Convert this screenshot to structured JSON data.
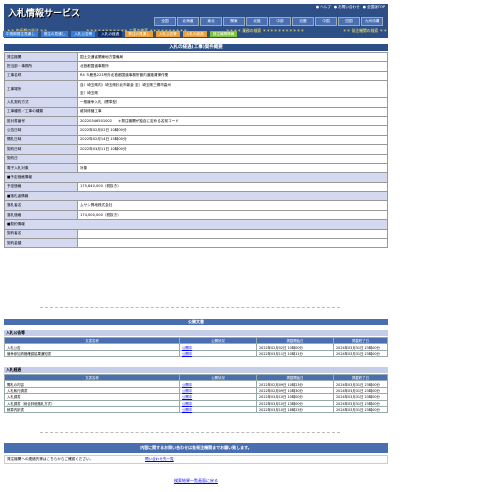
{
  "header": {
    "title": "入札情報サービス",
    "top_links": [
      "● ヘルプ",
      "● お問い合わせ",
      "● 全国版TOP"
    ],
    "regions": [
      "全国",
      "北海道",
      "東北",
      "関東",
      "北陸",
      "中部",
      "近畿",
      "中国",
      "四国",
      "九州沖縄"
    ],
    "search_links": [
      "＊＊ 中長期の発注 ＊＊",
      "＊＊＊＊＊＊＊＊＊＊＊ 工事の検索 ＊＊＊＊＊＊＊＊＊＊",
      "＊＊＊＊ 業務の検索 ＊＊＊＊＊＊＊＊＊＊＊",
      "＊＊ 発注機関の検索 ＊＊"
    ],
    "tabs": [
      "中長期発注見通し",
      "発注の見通し",
      "入札公告等",
      "入札の経過",
      "発注の見通し",
      "入札公告等",
      "入札の経過",
      "発注機関情報"
    ]
  },
  "section_title": "入札の経過(工事)案件概要",
  "info": [
    {
      "label": "発注機関",
      "value": "国土交通省関東地方整備局"
    },
    {
      "label": "担当部・事務所",
      "value": "北首都国道事務所"
    },
    {
      "label": "工事名称",
      "value": "R4 Ｓ鹿島223号外北首都国道事務所管内道路清掃作業"
    },
    {
      "label": "工事場所",
      "value": "自）埼玉県内）埼玉県杉北市新倉 至）埼玉県三郷市高州",
      "value2": "至）埼玉県"
    },
    {
      "label": "入札契約方式",
      "value": "一般競争入札（標準型）"
    },
    {
      "label": "工事種別／工事の種類",
      "value": "維持修繕工事"
    },
    {
      "label": "設計書番号",
      "value": "20220346501002",
      "note": "＊発注機関が独自に定める名前コード"
    },
    {
      "label": "公告日時",
      "value": "2022年02月02日 10時00分"
    },
    {
      "label": "開札日時",
      "value": "2022年02月14日 15時00分"
    },
    {
      "label": "契約日時",
      "value": "2022年03月11日 10時00分"
    },
    {
      "label": "契約日",
      "value": ""
    },
    {
      "label": "電子入札対象",
      "value": "対象"
    }
  ],
  "price_header": "■予定価格情報",
  "price_label": "予定価格",
  "price_value": "175,840,000（税抜き）",
  "winner_header": "■落札者情報",
  "winner_name_label": "落札者名",
  "winner_name": "ムサシ興地株式会社",
  "winner_price_label": "落札価格",
  "winner_price": "174,000,000（税抜き）",
  "contract_header": "■契約情報",
  "contract_rows": [
    {
      "label": "契約者名",
      "value": ""
    },
    {
      "label": "契約金額",
      "value": ""
    }
  ],
  "public_docs_title": "公開文書",
  "bid_notice": {
    "title": "入札公告等",
    "columns": [
      "文書名称",
      "公開状況",
      "掲載開始日",
      "掲載終了日"
    ],
    "rows": [
      [
        "入札公告",
        "公開中",
        "2022年02月02日 10時00分",
        "2024年03月31日 23時00分"
      ],
      [
        "競争参加資格確認結果通知書",
        "公開中",
        "2022年03月11日 10時11分",
        "2024年03月31日 23時00分"
      ]
    ]
  },
  "bid_progress": {
    "title": "入札経過",
    "columns": [
      "文書名称",
      "公開状況",
      "掲載開始日",
      "掲載終了日"
    ],
    "rows": [
      [
        "開札の内容",
        "公開中",
        "2022年02月09日 10時23分",
        "2024年03月31日 23時00分"
      ],
      [
        "入札執行調書",
        "公開中",
        "2022年02月09日 10時30分",
        "2024年03月31日 23時00分"
      ],
      [
        "入札調書",
        "公開中",
        "2022年03月10日 10時00分",
        "2024年03月31日 23時00分"
      ],
      [
        "入札調書（総合評価落札方式）",
        "公開中",
        "2022年03月10日 13時00分",
        "2024年03月31日 23時00分"
      ],
      [
        "積算内訳書",
        "公開中",
        "2022年03月10日 18時23分",
        "2024年03月31日 23時00分"
      ]
    ]
  },
  "notice_bar": "内容に関するお問い合わせは各発注機関までお願い致します。",
  "contact_text": "発注機関への連絡先等はこちらからご確認ください。",
  "contact_link": "問い合わせ先一覧",
  "back_link": "検索結果一覧画面に戻る"
}
